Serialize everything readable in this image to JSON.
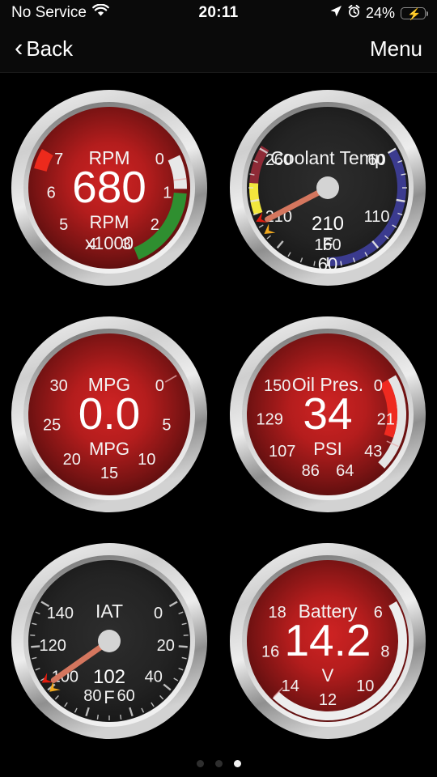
{
  "status_bar": {
    "carrier": "No Service",
    "wifi_icon": "wifi-icon",
    "time": "20:11",
    "location_icon": "location-arrow-icon",
    "alarm_icon": "alarm-clock-icon",
    "battery_percent": "24%",
    "battery_icon": "battery-charging-icon"
  },
  "nav": {
    "back_label": "Back",
    "back_icon": "chevron-left-icon",
    "menu_label": "Menu"
  },
  "gauges": [
    {
      "id": "rpm",
      "title": "RPM",
      "value": "680",
      "unit_line1": "RPM",
      "unit_line2": "x1000",
      "face": "red",
      "min": 0,
      "max": 7,
      "ticks": [
        "0",
        "1",
        "2",
        "3",
        "4",
        "5",
        "6",
        "7"
      ],
      "needle_value": 0.68,
      "bands": [
        {
          "name": "white-idle-band",
          "from": 0.15,
          "to": 0.9,
          "color": "#e8e8e8"
        },
        {
          "name": "green-band",
          "from": 1.0,
          "to": 2.85,
          "color": "#2f8f30"
        },
        {
          "name": "red-line-band",
          "from": 6.55,
          "to": 7.0,
          "color": "#ec2a1c"
        }
      ]
    },
    {
      "id": "coolant",
      "title": "Coolant Temp",
      "value": "210",
      "unit_line1": "F",
      "unit_line2": "60",
      "face": "dark",
      "min": 60,
      "max": 260,
      "ticks": [
        "60",
        "110",
        "160",
        "210",
        "260"
      ],
      "needle_value": 212,
      "marker_warn": 205,
      "marker_alert": 214,
      "bands": [
        {
          "name": "cold-band",
          "from": 60,
          "to": 160,
          "color": "#3b3b8f"
        },
        {
          "name": "warn-band",
          "from": 218,
          "to": 238,
          "color": "#f2e73d"
        },
        {
          "name": "hot-band",
          "from": 238,
          "to": 262,
          "color": "#8e2a36"
        }
      ]
    },
    {
      "id": "mpg",
      "title": "MPG",
      "value": "0.0",
      "unit_line1": "MPG",
      "unit_line2": "",
      "face": "red",
      "min": 0,
      "max": 30,
      "ticks": [
        "0",
        "5",
        "10",
        "15",
        "20",
        "25",
        "30"
      ],
      "needle_value": 0,
      "bands": []
    },
    {
      "id": "oil",
      "title": "Oil Pres.",
      "value": "34",
      "unit_line1": "PSI",
      "unit_line2": "",
      "face": "red",
      "min": 0,
      "max": 150,
      "ticks": [
        "0",
        "21",
        "43",
        "64",
        "86",
        "107",
        "129",
        "150"
      ],
      "needle_value": 34,
      "bands": [
        {
          "name": "oil-track-band",
          "from": 0,
          "to": 46,
          "color": "#e4e4e4"
        },
        {
          "name": "oil-value-band",
          "from": 0,
          "to": 31,
          "color": "#ef2a20"
        }
      ]
    },
    {
      "id": "iat",
      "title": "IAT",
      "value": "102",
      "unit_line1": "F",
      "unit_line2": "",
      "face": "dark",
      "min": 0,
      "max": 140,
      "ticks": [
        "0",
        "20",
        "40",
        "60",
        "80",
        "100",
        "120",
        "140"
      ],
      "needle_value": 102,
      "marker_warn": 99,
      "marker_alert": 104,
      "bands": []
    },
    {
      "id": "battery",
      "title": "Battery",
      "value": "14.2",
      "unit_line1": "V",
      "unit_line2": "",
      "face": "red",
      "min": 6,
      "max": 18,
      "ticks": [
        "6",
        "8",
        "10",
        "12",
        "14",
        "16",
        "18"
      ],
      "needle_value": 14.2,
      "bands": [
        {
          "name": "battery-value-band",
          "from": 6,
          "to": 14.2,
          "color": "#ededed"
        }
      ]
    }
  ],
  "pagination": {
    "count": 3,
    "active_index": 2
  },
  "colors": {
    "bezel_outer": "#d9d9d9",
    "bezel_inner": "#9a9a9a",
    "face_red": "#b31c1c",
    "face_dark": "#242424",
    "accent_green": "#2f8f30",
    "accent_red": "#ec2a1c",
    "accent_yellow": "#f2e73d",
    "accent_blue": "#3b3b8f"
  }
}
